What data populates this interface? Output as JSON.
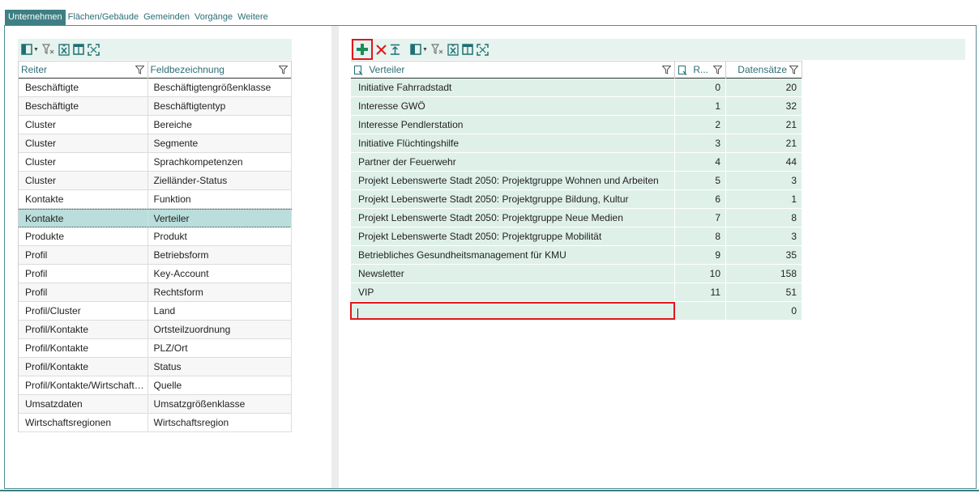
{
  "tabs": [
    {
      "label": "Unternehmen",
      "active": true
    },
    {
      "label": "Flächen/Gebäude",
      "active": false
    },
    {
      "label": "Gemeinden",
      "active": false
    },
    {
      "label": "Vorgänge",
      "active": false
    },
    {
      "label": "Weitere",
      "active": false
    }
  ],
  "left_grid": {
    "columns": [
      "Reiter",
      "Feldbezeichnung"
    ],
    "selected_index": 7,
    "rows": [
      [
        "Beschäftigte",
        "Beschäftigtengrößenklasse"
      ],
      [
        "Beschäftigte",
        "Beschäftigtentyp"
      ],
      [
        "Cluster",
        "Bereiche"
      ],
      [
        "Cluster",
        "Segmente"
      ],
      [
        "Cluster",
        "Sprachkompetenzen"
      ],
      [
        "Cluster",
        "Zielländer-Status"
      ],
      [
        "Kontakte",
        "Funktion"
      ],
      [
        "Kontakte",
        "Verteiler"
      ],
      [
        "Produkte",
        "Produkt"
      ],
      [
        "Profil",
        "Betriebsform"
      ],
      [
        "Profil",
        "Key-Account"
      ],
      [
        "Profil",
        "Rechtsform"
      ],
      [
        "Profil/Cluster",
        "Land"
      ],
      [
        "Profil/Kontakte",
        "Ortsteilzuordnung"
      ],
      [
        "Profil/Kontakte",
        "PLZ/Ort"
      ],
      [
        "Profil/Kontakte",
        "Status"
      ],
      [
        "Profil/Kontakte/Wirtschaftsr...",
        "Quelle"
      ],
      [
        "Umsatzdaten",
        "Umsatzgrößenklasse"
      ],
      [
        "Wirtschaftsregionen",
        "Wirtschaftsregion"
      ]
    ]
  },
  "right_grid": {
    "columns": [
      "Verteiler",
      "R...",
      "Datensätze"
    ],
    "rows": [
      [
        "Initiative Fahrradstadt",
        "0",
        "20"
      ],
      [
        "Interesse GWÖ",
        "1",
        "32"
      ],
      [
        "Interesse Pendlerstation",
        "2",
        "21"
      ],
      [
        "Initiative Flüchtingshilfe",
        "3",
        "21"
      ],
      [
        "Partner der Feuerwehr",
        "4",
        "44"
      ],
      [
        "Projekt Lebenswerte Stadt 2050: Projektgruppe Wohnen und Arbeiten",
        "5",
        "3"
      ],
      [
        "Projekt Lebenswerte Stadt 2050: Projektgruppe Bildung, Kultur",
        "6",
        "1"
      ],
      [
        "Projekt Lebenswerte Stadt 2050: Projektgruppe Neue Medien",
        "7",
        "8"
      ],
      [
        "Projekt Lebenswerte Stadt 2050: Projektgruppe Mobilität",
        "8",
        "3"
      ],
      [
        "Betriebliches Gesundheitsmanagement für KMU",
        "9",
        "35"
      ],
      [
        "Newsletter",
        "10",
        "158"
      ],
      [
        "VIP",
        "11",
        "51"
      ]
    ],
    "new_row": {
      "verteiler": "",
      "r": "",
      "datensaetze": "0"
    }
  },
  "colors": {
    "accent": "#3e7f84",
    "header_text": "#2c6e75",
    "toolbar_bg": "#e6f3ee",
    "row_bg": "#dff0e9",
    "selected_bg": "#b9dedb",
    "highlight": "#e0161d"
  },
  "icons": {
    "left_toolbar": [
      "column-chooser-icon",
      "clear-filter-icon",
      "excel-export-icon",
      "layout-icon",
      "fit-columns-icon"
    ],
    "right_toolbar": [
      "add-icon",
      "delete-icon",
      "sort-icon",
      "column-chooser-icon",
      "clear-filter-icon",
      "excel-export-icon",
      "layout-icon",
      "fit-columns-icon"
    ]
  }
}
